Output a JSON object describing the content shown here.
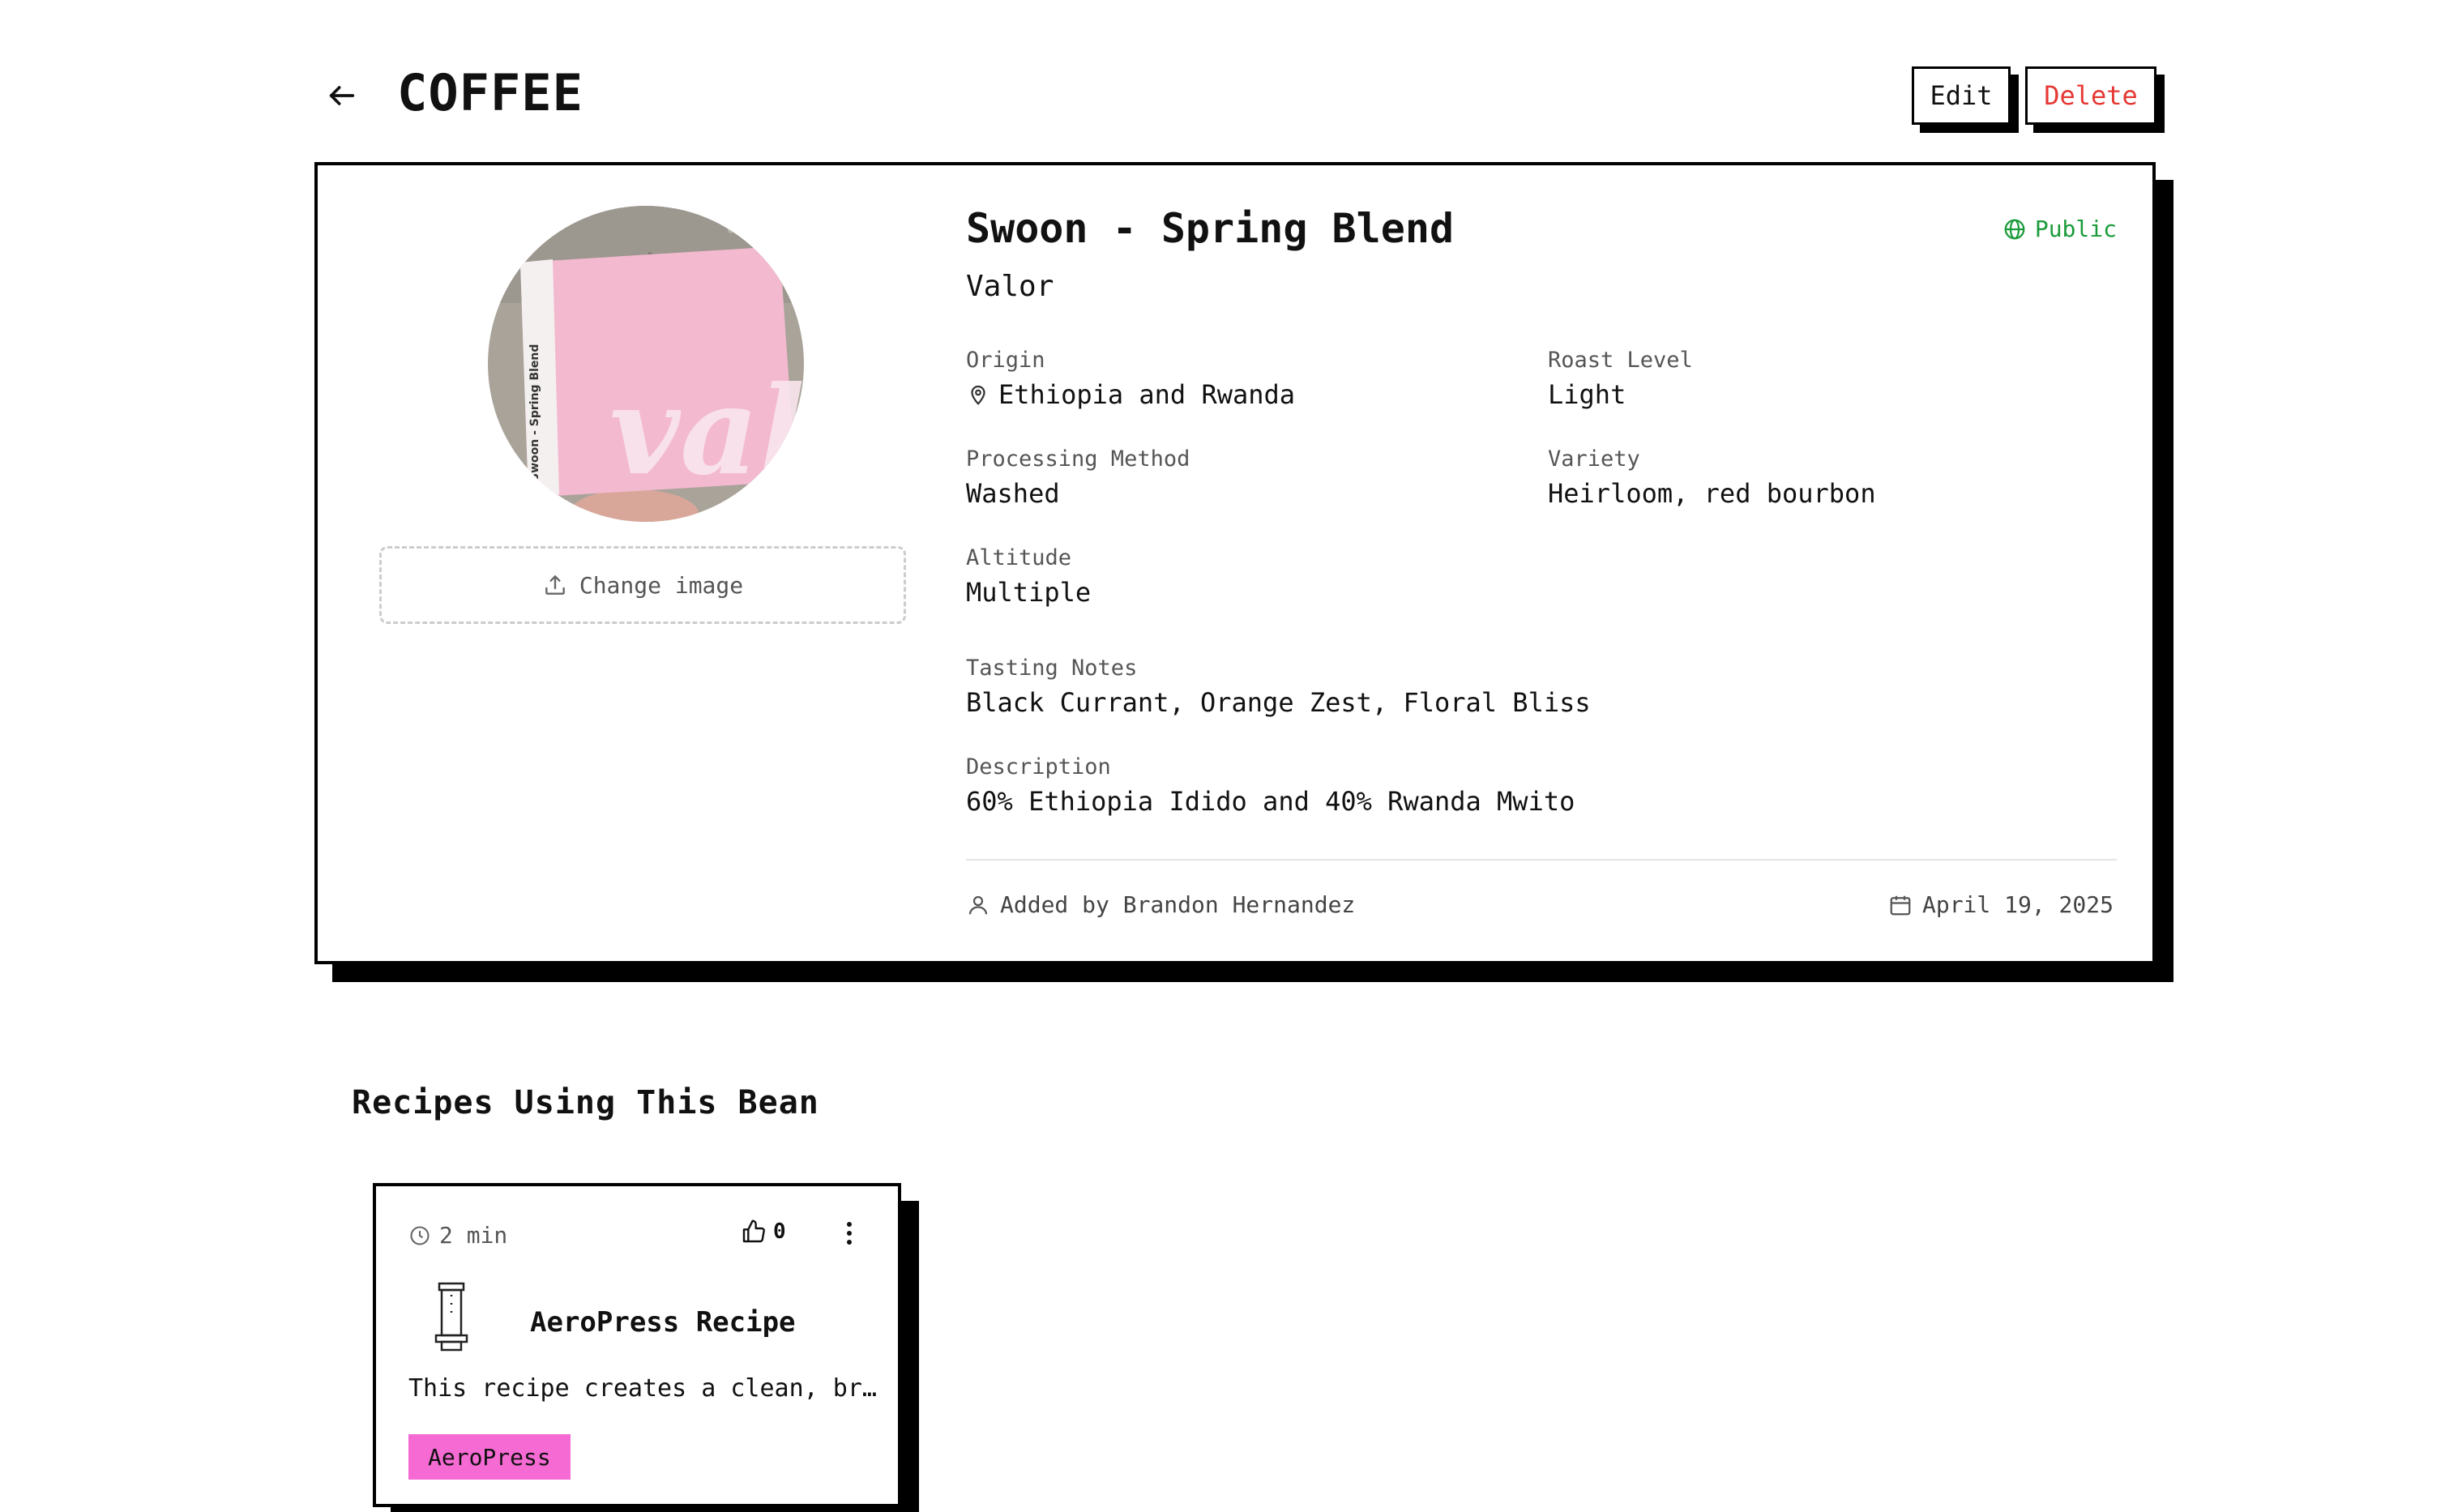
{
  "header": {
    "title": "COFFEE",
    "edit_label": "Edit",
    "delete_label": "Delete"
  },
  "bean": {
    "name": "Swoon - Spring Blend",
    "roaster": "Valor",
    "visibility": "Public",
    "change_image_label": "Change image",
    "image_text": "valor",
    "fields": {
      "origin": {
        "label": "Origin",
        "value": "Ethiopia and Rwanda"
      },
      "roast_level": {
        "label": "Roast Level",
        "value": "Light"
      },
      "processing": {
        "label": "Processing Method",
        "value": "Washed"
      },
      "variety": {
        "label": "Variety",
        "value": "Heirloom, red bourbon"
      },
      "altitude": {
        "label": "Altitude",
        "value": "Multiple"
      },
      "tasting_notes": {
        "label": "Tasting Notes",
        "value": "Black Currant, Orange Zest, Floral Bliss"
      },
      "description": {
        "label": "Description",
        "value": "60% Ethiopia Idido and 40% Rwanda Mwito"
      }
    },
    "added_by": "Added by Brandon Hernandez",
    "date": "April 19, 2025"
  },
  "recipes_section": {
    "title": "Recipes Using This Bean",
    "recipes": [
      {
        "time": "2 min",
        "likes": "0",
        "title": "AeroPress Recipe",
        "description": "This recipe creates a clean, bright cup",
        "tag": "AeroPress"
      }
    ]
  },
  "colors": {
    "public_green": "#1a9b3a",
    "delete_red": "#e53935",
    "tag_pink": "#f56ad3",
    "image_pink": "#f3b9cf"
  },
  "icons": [
    "arrow-left-icon",
    "globe-icon",
    "map-pin-icon",
    "upload-icon",
    "user-icon",
    "calendar-icon",
    "clock-icon",
    "thumbs-up-icon",
    "more-vertical-icon",
    "aeropress-icon"
  ]
}
